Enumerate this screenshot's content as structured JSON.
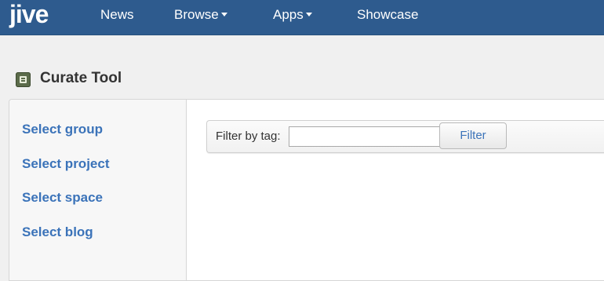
{
  "topbar": {
    "logo_text": "jive",
    "nav": [
      {
        "label": "News"
      },
      {
        "label": "Browse"
      },
      {
        "label": "Apps"
      },
      {
        "label": "Showcase"
      }
    ]
  },
  "page": {
    "title": "Curate Tool"
  },
  "sidebar": {
    "links": [
      {
        "label": "Select group"
      },
      {
        "label": "Select project"
      },
      {
        "label": "Select space"
      },
      {
        "label": "Select blog"
      }
    ]
  },
  "filter": {
    "label": "Filter by tag:",
    "input_value": "",
    "button_label": "Filter"
  },
  "colors": {
    "header_bg": "#2e5b8e",
    "link": "#3b73b9",
    "page_bg": "#f0f0f0"
  }
}
